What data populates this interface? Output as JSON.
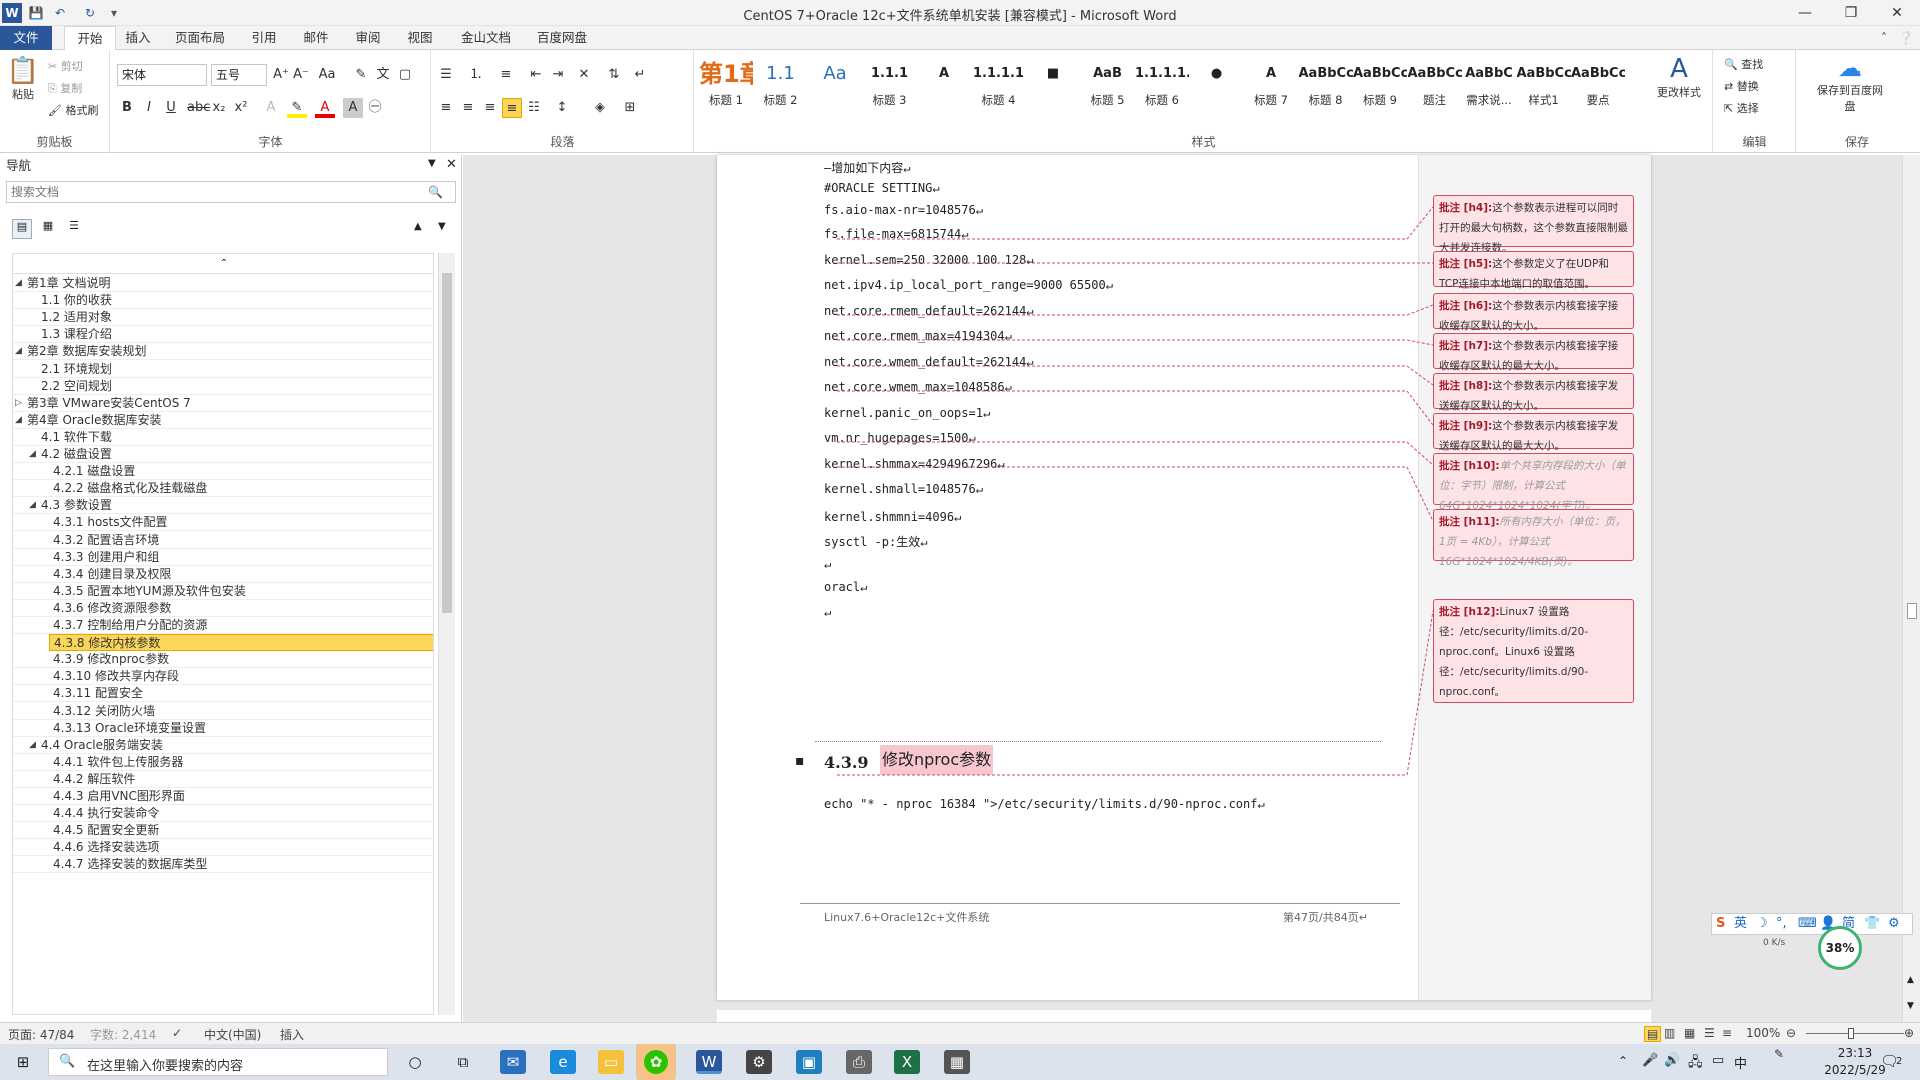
{
  "window": {
    "title": "CentOS 7+Oracle 12c+文件系统单机安装 [兼容模式] - Microsoft Word"
  },
  "tabs": [
    "文件",
    "开始",
    "插入",
    "页面布局",
    "引用",
    "邮件",
    "审阅",
    "视图",
    "金山文档",
    "百度网盘"
  ],
  "ribbon": {
    "clipboard": {
      "label": "剪贴板",
      "paste": "粘贴",
      "cut": "剪切",
      "copy": "复制",
      "format_painter": "格式刷"
    },
    "font": {
      "label": "字体",
      "font_name": "宋体",
      "font_size": "五号"
    },
    "paragraph": {
      "label": "段落"
    },
    "styles": {
      "label": "样式",
      "items": [
        {
          "preview": "第1章",
          "name": "标题 1"
        },
        {
          "preview": "1.1",
          "name": "标题 2"
        },
        {
          "preview": "Aa",
          "name": ""
        },
        {
          "preview": "1.1.1",
          "name": "标题 3"
        },
        {
          "preview": "A",
          "name": ""
        },
        {
          "preview": "1.1.1.1",
          "name": "标题 4"
        },
        {
          "preview": "■",
          "name": ""
        },
        {
          "preview": "AaB",
          "name": "标题 5"
        },
        {
          "preview": "1.1.1.1.",
          "name": "标题 6"
        },
        {
          "preview": "●",
          "name": ""
        },
        {
          "preview": "A",
          "name": "标题 7"
        },
        {
          "preview": "AaBbCcI",
          "name": "标题 8"
        },
        {
          "preview": "AaBbCcD",
          "name": "标题 9"
        },
        {
          "preview": "AaBbCcD",
          "name": "题注"
        },
        {
          "preview": "AaBbC",
          "name": "需求说..."
        },
        {
          "preview": "AaBbCcD",
          "name": "样式1"
        },
        {
          "preview": "AaBbCcD",
          "name": "要点"
        }
      ],
      "change": "更改样式"
    },
    "editing": {
      "label": "编辑",
      "find": "查找",
      "replace": "替换",
      "select": "选择"
    },
    "save": {
      "label": "保存",
      "button": "保存到百度网盘"
    }
  },
  "nav": {
    "title": "导航",
    "search_placeholder": "搜索文档",
    "items": [
      {
        "level": 1,
        "text": "第1章  文档说明",
        "expanded": true
      },
      {
        "level": 2,
        "text": "1.1 你的收获"
      },
      {
        "level": 2,
        "text": "1.2 适用对象"
      },
      {
        "level": 2,
        "text": "1.3 课程介绍"
      },
      {
        "level": 1,
        "text": "第2章  数据库安装规划",
        "expanded": true
      },
      {
        "level": 2,
        "text": "2.1 环境规划"
      },
      {
        "level": 2,
        "text": "2.2 空间规划"
      },
      {
        "level": 1,
        "text": "第3章  VMware安装CentOS 7",
        "expanded": false
      },
      {
        "level": 1,
        "text": "第4章  Oracle数据库安装",
        "expanded": true
      },
      {
        "level": 2,
        "text": "4.1 软件下载"
      },
      {
        "level": 2,
        "text": "4.2 磁盘设置",
        "expanded": true
      },
      {
        "level": 3,
        "text": "4.2.1 磁盘设置"
      },
      {
        "level": 3,
        "text": "4.2.2 磁盘格式化及挂载磁盘"
      },
      {
        "level": 2,
        "text": "4.3 参数设置",
        "expanded": true
      },
      {
        "level": 3,
        "text": "4.3.1 hosts文件配置"
      },
      {
        "level": 3,
        "text": "4.3.2 配置语言环境"
      },
      {
        "level": 3,
        "text": "4.3.3 创建用户和组"
      },
      {
        "level": 3,
        "text": "4.3.4 创建目录及权限"
      },
      {
        "level": 3,
        "text": "4.3.5 配置本地YUM源及软件包安装"
      },
      {
        "level": 3,
        "text": "4.3.6 修改资源限参数"
      },
      {
        "level": 3,
        "text": "4.3.7 控制给用户分配的资源"
      },
      {
        "level": 3,
        "text": "4.3.8 修改内核参数",
        "selected": true
      },
      {
        "level": 3,
        "text": "4.3.9 修改nproc参数"
      },
      {
        "level": 3,
        "text": "4.3.10 修改共享内存段"
      },
      {
        "level": 3,
        "text": "4.3.11 配置安全"
      },
      {
        "level": 3,
        "text": "4.3.12 关闭防火墙"
      },
      {
        "level": 3,
        "text": "4.3.13 Oracle环境变量设置"
      },
      {
        "level": 2,
        "text": "4.4 Oracle服务端安装",
        "expanded": true
      },
      {
        "level": 3,
        "text": "4.4.1 软件包上传服务器"
      },
      {
        "level": 3,
        "text": "4.4.2 解压软件"
      },
      {
        "level": 3,
        "text": "4.4.3 启用VNC图形界面"
      },
      {
        "level": 3,
        "text": "4.4.4 执行安装命令"
      },
      {
        "level": 3,
        "text": "4.4.5 配置安全更新"
      },
      {
        "level": 3,
        "text": "4.4.6 选择安装选项"
      },
      {
        "level": 3,
        "text": "4.4.7 选择安装的数据库类型"
      }
    ]
  },
  "doc": {
    "lines": [
      "—增加如下内容↵",
      "#ORACLE SETTING↵",
      "fs.aio-max-nr=1048576↵",
      "fs.file-max=6815744↵",
      "kernel.sem=250 32000 100 128↵",
      "net.ipv4.ip_local_port_range=9000 65500↵",
      "net.core.rmem_default=262144↵",
      "net.core.rmem_max=4194304↵",
      "net.core.wmem_default=262144↵",
      "net.core.wmem_max=1048586↵",
      "kernel.panic_on_oops=1↵",
      "vm.nr_hugepages=1500↵",
      "kernel.shmmax=4294967296↵",
      "kernel.shmall=1048576↵",
      "kernel.shmmni=4096↵",
      "sysctl -p:生效↵",
      "↵",
      "oracl↵",
      "↵"
    ],
    "heading_num": "4.3.9",
    "heading_text": "修改nproc参数",
    "echo_line": "echo \"* - nproc 16384 \">/etc/security/limits.d/90-nproc.conf↵",
    "footer_left": "Linux7.6+Oracle12c+文件系统",
    "footer_right": "第47页/共84页↵"
  },
  "comments": [
    {
      "tag": "批注 [h4]:",
      "text": "这个参数表示进程可以同时打开的最大句柄数，这个参数直接限制最大并发连接数。"
    },
    {
      "tag": "批注 [h5]:",
      "text": "这个参数定义了在UDP和TCP连接中本地端口的取值范围。"
    },
    {
      "tag": "批注 [h6]:",
      "text": "这个参数表示内核套接字接收缓存区默认的大小。"
    },
    {
      "tag": "批注 [h7]:",
      "text": "这个参数表示内核套接字接收缓存区默认的最大大小。"
    },
    {
      "tag": "批注 [h8]:",
      "text": "这个参数表示内核套接字发送缓存区默认的大小。"
    },
    {
      "tag": "批注 [h9]:",
      "text": "这个参数表示内核套接字发送缓存区默认的最大大小。"
    },
    {
      "tag": "批注 [h10]:",
      "text": "单个共享内存段的大小（单位：字节）限制，计算公式64G*1024*1024*1024(字节)。"
    },
    {
      "tag": "批注 [h11]:",
      "text": "所有内存大小（单位：页，1页 = 4Kb），计算公式16G*1024*1024/4KB(页)。"
    },
    {
      "tag": "批注 [h12]:",
      "text": "Linux7 设置路径：/etc/security/limits.d/20-nproc.conf。Linux6 设置路径：/etc/security/limits.d/90-nproc.conf。"
    }
  ],
  "status": {
    "page": "页面: 47/84",
    "words": "字数: 2,414",
    "lang": "中文(中国)",
    "mode": "插入",
    "zoom": "100%"
  },
  "ime": {
    "lang": "英",
    "net": "0 K/s",
    "pct": "38%"
  },
  "taskbar": {
    "search_placeholder": "在这里输入你要搜索的内容",
    "time": "23:13",
    "date": "2022/5/29",
    "notif": "2"
  }
}
